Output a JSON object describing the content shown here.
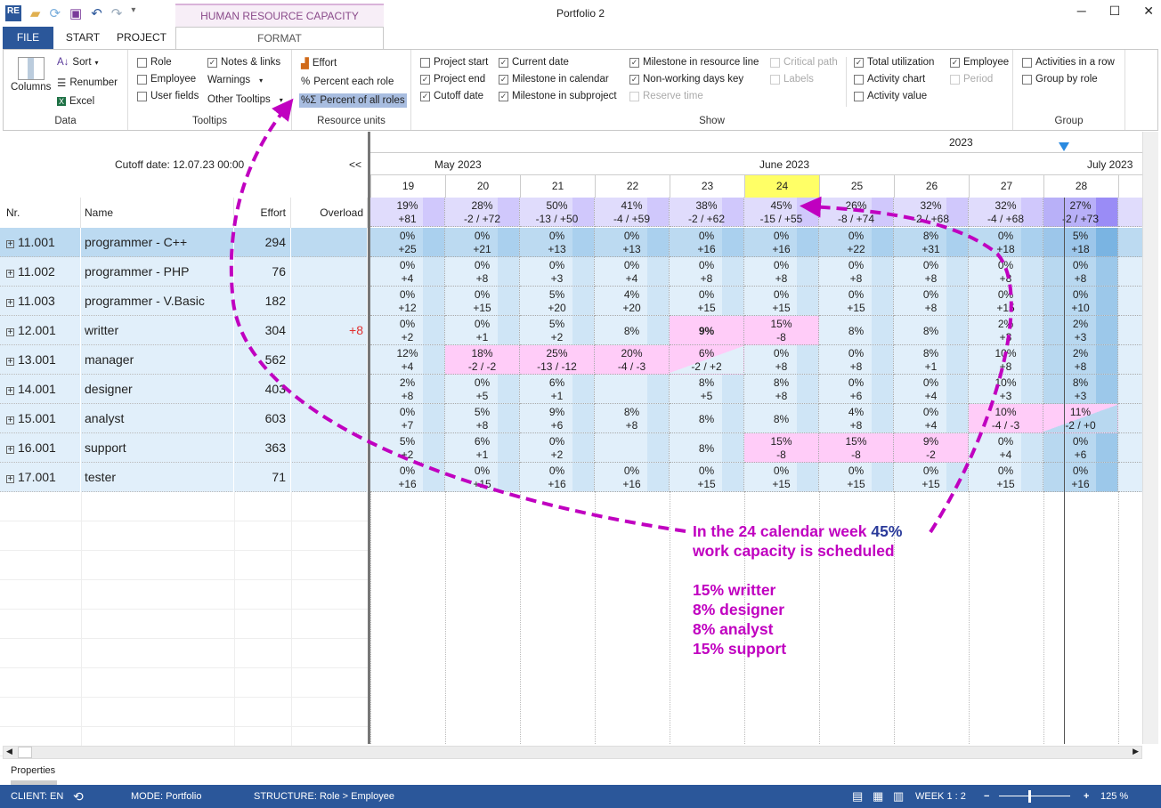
{
  "window": {
    "title": "Portfolio 2",
    "context_tab": "HUMAN RESOURCE CAPACITY PLANNING",
    "minimize": "─",
    "maximize": "☐",
    "close": "✕"
  },
  "quick_access": [
    "app-logo",
    "folder-icon",
    "refresh-icon",
    "save-icon",
    "undo-icon",
    "redo-icon",
    "customize-icon"
  ],
  "tabs": {
    "file": "FILE",
    "start": "START",
    "project": "PROJECT",
    "format": "FORMAT"
  },
  "ribbon": {
    "data": {
      "label": "Data",
      "columns": "Columns",
      "sort": "Sort",
      "renumber": "Renumber",
      "excel": "Excel"
    },
    "tooltips": {
      "label": "Tooltips",
      "role": "Role",
      "employee": "Employee",
      "user_fields": "User fields",
      "notes": "Notes & links",
      "warnings": "Warnings",
      "other": "Other Tooltips"
    },
    "resource_units": {
      "label": "Resource units",
      "effort": "Effort",
      "percent_each": "Percent each role",
      "percent_all": "Percent of all roles"
    },
    "show": {
      "label": "Show",
      "items": [
        {
          "label": "Project start",
          "checked": false
        },
        {
          "label": "Project end",
          "checked": true
        },
        {
          "label": "Cutoff date",
          "checked": true
        },
        {
          "label": "Current date",
          "checked": true
        },
        {
          "label": "Milestone in calendar",
          "checked": true
        },
        {
          "label": "Milestone in subproject",
          "checked": true
        },
        {
          "label": "Milestone in resource line",
          "checked": true
        },
        {
          "label": "Non-working days key",
          "checked": true
        },
        {
          "label": "Reserve time",
          "checked": false,
          "disabled": true
        },
        {
          "label": "Critical path",
          "checked": false,
          "disabled": true
        },
        {
          "label": "Labels",
          "checked": false,
          "disabled": true
        },
        {
          "label": "Total utilization",
          "checked": true
        },
        {
          "label": "Activity chart",
          "checked": false
        },
        {
          "label": "Activity value",
          "checked": false
        },
        {
          "label": "Employee",
          "checked": true
        },
        {
          "label": "Period",
          "checked": false,
          "disabled": true
        }
      ]
    },
    "group": {
      "label": "Group",
      "activities_row": "Activities in a row",
      "group_by_role": "Group by role"
    }
  },
  "left": {
    "cutoff": "Cutoff date:  12.07.23 00:00",
    "collapse": "<<",
    "headers": {
      "nr": "Nr.",
      "name": "Name",
      "effort": "Effort",
      "overload": "Overload"
    },
    "rows": [
      {
        "nr": "11.001",
        "name": "programmer - C++",
        "effort": "294",
        "overload": ""
      },
      {
        "nr": "11.002",
        "name": "programmer - PHP",
        "effort": "76",
        "overload": ""
      },
      {
        "nr": "11.003",
        "name": "programmer - V.Basic",
        "effort": "182",
        "overload": ""
      },
      {
        "nr": "12.001",
        "name": "writter",
        "effort": "304",
        "overload": "+8"
      },
      {
        "nr": "13.001",
        "name": "manager",
        "effort": "562",
        "overload": ""
      },
      {
        "nr": "14.001",
        "name": "designer",
        "effort": "403",
        "overload": ""
      },
      {
        "nr": "15.001",
        "name": "analyst",
        "effort": "603",
        "overload": ""
      },
      {
        "nr": "16.001",
        "name": "support",
        "effort": "363",
        "overload": ""
      },
      {
        "nr": "17.001",
        "name": "tester",
        "effort": "71",
        "overload": ""
      }
    ]
  },
  "timeline": {
    "year": "2023",
    "months": [
      "May 2023",
      "June 2023",
      "July 2023"
    ],
    "weeks": [
      "19",
      "20",
      "21",
      "22",
      "23",
      "24",
      "25",
      "26",
      "27",
      "28"
    ],
    "current_week": "24",
    "totals": [
      [
        "19%",
        "+81"
      ],
      [
        "28%",
        "-2 / +72"
      ],
      [
        "50%",
        "-13 / +50"
      ],
      [
        "41%",
        "-4 / +59"
      ],
      [
        "38%",
        "-2 / +62"
      ],
      [
        "45%",
        "-15 / +55"
      ],
      [
        "26%",
        "-8 / +74"
      ],
      [
        "32%",
        "-2 / +68"
      ],
      [
        "32%",
        "-4 / +68"
      ],
      [
        "27%",
        "-2 / +73"
      ]
    ],
    "rows": [
      [
        [
          "0%",
          "+25"
        ],
        [
          "0%",
          "+21"
        ],
        [
          "0%",
          "+13"
        ],
        [
          "0%",
          "+13"
        ],
        [
          "0%",
          "+16"
        ],
        [
          "0%",
          "+16"
        ],
        [
          "0%",
          "+22"
        ],
        [
          "8%",
          "+31"
        ],
        [
          "0%",
          "+18"
        ],
        [
          "5%",
          "+18"
        ]
      ],
      [
        [
          "0%",
          "+4"
        ],
        [
          "0%",
          "+8"
        ],
        [
          "0%",
          "+3"
        ],
        [
          "0%",
          "+4"
        ],
        [
          "0%",
          "+8"
        ],
        [
          "0%",
          "+8"
        ],
        [
          "0%",
          "+8"
        ],
        [
          "0%",
          "+8"
        ],
        [
          "0%",
          "+8"
        ],
        [
          "0%",
          "+8"
        ]
      ],
      [
        [
          "0%",
          "+12"
        ],
        [
          "0%",
          "+15"
        ],
        [
          "5%",
          "+20"
        ],
        [
          "4%",
          "+20"
        ],
        [
          "0%",
          "+15"
        ],
        [
          "0%",
          "+15"
        ],
        [
          "0%",
          "+15"
        ],
        [
          "0%",
          "+8"
        ],
        [
          "0%",
          "+15"
        ],
        [
          "0%",
          "+10"
        ]
      ],
      [
        [
          "0%",
          "+2"
        ],
        [
          "0%",
          "+1"
        ],
        [
          "5%",
          "+2"
        ],
        [
          "8%",
          ""
        ],
        [
          "9%",
          "",
          "over"
        ],
        [
          "15%",
          "-8",
          "over"
        ],
        [
          "8%",
          ""
        ],
        [
          "8%",
          ""
        ],
        [
          "2%",
          "+3"
        ],
        [
          "2%",
          "+3"
        ]
      ],
      [
        [
          "12%",
          "+4"
        ],
        [
          "18%",
          "-2 / -2",
          "over"
        ],
        [
          "25%",
          "-13 / -12",
          "over"
        ],
        [
          "20%",
          "-4 / -3",
          "over"
        ],
        [
          "6%",
          "-2 / +2",
          "partial"
        ],
        [
          "0%",
          "+8"
        ],
        [
          "0%",
          "+8"
        ],
        [
          "8%",
          "+1"
        ],
        [
          "10%",
          "+8"
        ],
        [
          "2%",
          "+8"
        ]
      ],
      [
        [
          "2%",
          "+8"
        ],
        [
          "0%",
          "+5"
        ],
        [
          "6%",
          "+1"
        ],
        [
          "",
          ""
        ],
        [
          "8%",
          "+5"
        ],
        [
          "8%",
          "+8"
        ],
        [
          "0%",
          "+6"
        ],
        [
          "0%",
          "+4"
        ],
        [
          "10%",
          "+3"
        ],
        [
          "8%",
          "+3"
        ]
      ],
      [
        [
          "0%",
          "+7"
        ],
        [
          "5%",
          "+8"
        ],
        [
          "9%",
          "+6"
        ],
        [
          "8%",
          "+8"
        ],
        [
          "8%",
          ""
        ],
        [
          "8%",
          ""
        ],
        [
          "4%",
          "+8"
        ],
        [
          "0%",
          "+4"
        ],
        [
          "10%",
          "-4 / -3",
          "over"
        ],
        [
          "11%",
          "-2 / +0",
          "partial"
        ]
      ],
      [
        [
          "5%",
          "+2"
        ],
        [
          "6%",
          "+1"
        ],
        [
          "0%",
          "+2"
        ],
        [
          "",
          ""
        ],
        [
          "8%",
          ""
        ],
        [
          "15%",
          "-8",
          "over"
        ],
        [
          "15%",
          "-8",
          "over"
        ],
        [
          "9%",
          "-2",
          "over"
        ],
        [
          "0%",
          "+4"
        ],
        [
          "0%",
          "+6"
        ]
      ],
      [
        [
          "0%",
          "+16"
        ],
        [
          "0%",
          "+15"
        ],
        [
          "0%",
          "+16"
        ],
        [
          "0%",
          "+16"
        ],
        [
          "0%",
          "+15"
        ],
        [
          "0%",
          "+15"
        ],
        [
          "0%",
          "+15"
        ],
        [
          "0%",
          "+15"
        ],
        [
          "0%",
          "+15"
        ],
        [
          "0%",
          "+16"
        ]
      ]
    ]
  },
  "annotation": {
    "line1a": "In the 24 calendar week ",
    "line1b": "45%",
    "line2": "work capacity is scheduled",
    "items": [
      "15% writter",
      "8%   designer",
      "8%   analyst",
      "15% support"
    ]
  },
  "properties": "Properties",
  "status": {
    "client": "CLIENT: EN",
    "mode": "MODE: Portfolio",
    "structure": "STRUCTURE: Role > Employee",
    "week": "WEEK 1 : 2",
    "zoom": "125 %"
  },
  "colors": {
    "accent": "#2b579a",
    "overload": "#ffccf8",
    "annotation": "#c000c0",
    "row": "#e1effa",
    "selected_row": "#bcdaf1",
    "current_week": "#ffff66",
    "totals": "#e0dcfc"
  }
}
